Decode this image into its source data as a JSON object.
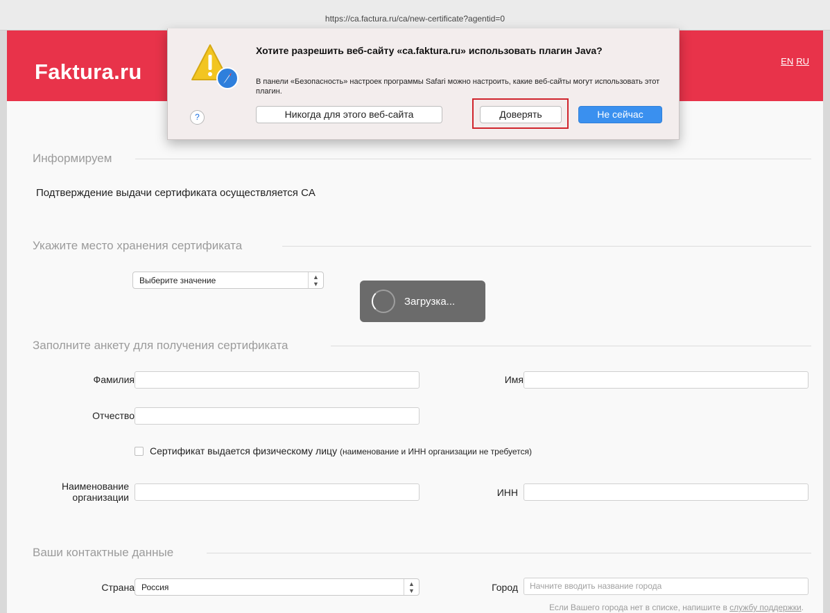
{
  "browser": {
    "url": "https://ca.factura.ru/ca/new-certificate?agentid=0"
  },
  "header": {
    "logo": "Faktura.ru",
    "lang_en": "EN",
    "lang_ru": "RU",
    "brand_color": "#e8334a"
  },
  "dialog": {
    "title": "Хотите разрешить веб-сайту «ca.faktura.ru» использовать плагин Java?",
    "message": "В панели «Безопасность» настроек программы Safari можно настроить, какие веб-сайты могут использовать этот плагин.",
    "help_label": "?",
    "never_label": "Никогда для этого веб-сайта",
    "trust_label": "Доверять",
    "not_now_label": "Не сейчас"
  },
  "sections": {
    "inform": "Информируем",
    "inform_text": "Подтверждение выдачи сертификата осуществляется CA",
    "storage": "Укажите место хранения сертификата",
    "form": "Заполните анкету для получения сертификата",
    "contacts": "Ваши контактные данные"
  },
  "storage_select": {
    "value": "Выберите значение"
  },
  "loading": {
    "text": "Загрузка..."
  },
  "form": {
    "surname_label": "Фамилия",
    "name_label": "Имя",
    "patronymic_label": "Отчество",
    "individual_checkbox_label": "Сертификат выдается физическому лицу",
    "individual_checkbox_note": "(наименование и ИНН организации не требуется)",
    "org_name_label_1": "Наименование",
    "org_name_label_2": "организации",
    "inn_label": "ИНН"
  },
  "contacts": {
    "country_label": "Страна",
    "country_value": "Россия",
    "city_label": "Город",
    "city_placeholder": "Начните вводить название города",
    "hint_text": "Если Вашего города нет в списке, напишите в",
    "hint_link": "службу поддержки",
    "hint_end": "."
  }
}
